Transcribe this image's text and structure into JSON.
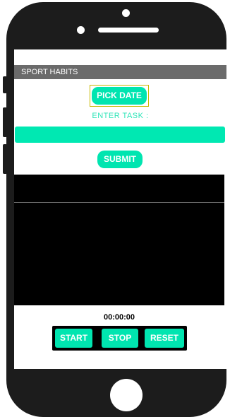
{
  "app": {
    "title": "SPORT HABITS"
  },
  "date_picker": {
    "label": "PICK DATE"
  },
  "task": {
    "label": "ENTER TASK :",
    "value": "",
    "placeholder": ""
  },
  "submit": {
    "label": "SUBMIT"
  },
  "timer": {
    "display": "00:00:00",
    "start_label": "START",
    "stop_label": "STOP",
    "reset_label": "RESET"
  },
  "colors": {
    "accent": "#00e5b0",
    "header": "#6b6b6b",
    "phone_body": "#1c1c1c"
  }
}
